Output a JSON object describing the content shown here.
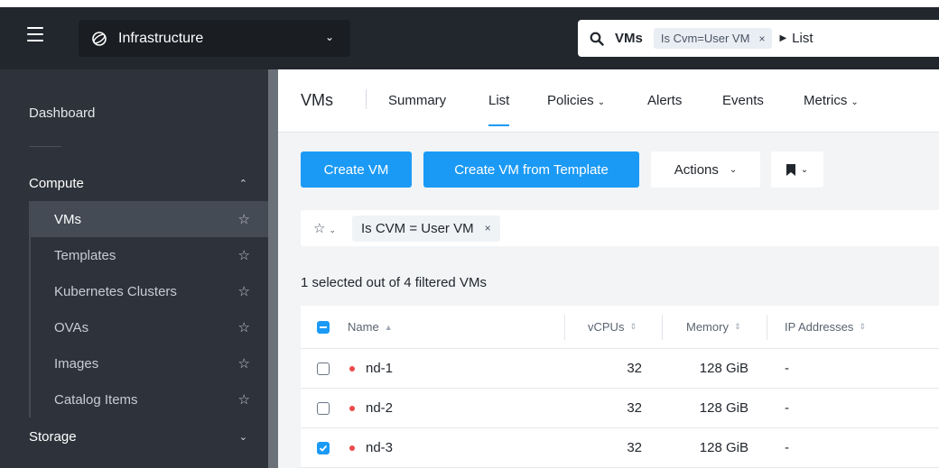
{
  "header": {
    "app_name": "Infrastructure",
    "search": {
      "scope": "VMs",
      "chip": "Is Cvm=User VM",
      "chip_remove": "×",
      "view": "List"
    }
  },
  "sidebar": {
    "dashboard": "Dashboard",
    "compute_label": "Compute",
    "compute_items": [
      {
        "label": "VMs",
        "active": true
      },
      {
        "label": "Templates"
      },
      {
        "label": "Kubernetes Clusters"
      },
      {
        "label": "OVAs"
      },
      {
        "label": "Images"
      },
      {
        "label": "Catalog Items"
      }
    ],
    "storage_label": "Storage"
  },
  "page": {
    "title": "VMs",
    "tabs": [
      "Summary",
      "List",
      "Policies",
      "Alerts",
      "Events",
      "Metrics"
    ],
    "active_tab": "List"
  },
  "toolbar": {
    "create_vm": "Create VM",
    "create_from_template": "Create VM from Template",
    "actions": "Actions"
  },
  "filter": {
    "chip": "Is CVM = User VM",
    "chip_remove": "×"
  },
  "selection_text": "1 selected out of 4 filtered VMs",
  "table": {
    "columns": [
      "Name",
      "vCPUs",
      "Memory",
      "IP Addresses"
    ],
    "rows": [
      {
        "name": "nd-1",
        "vcpus": "32",
        "memory": "128 GiB",
        "ip": "-",
        "selected": false
      },
      {
        "name": "nd-2",
        "vcpus": "32",
        "memory": "128 GiB",
        "ip": "-",
        "selected": false
      },
      {
        "name": "nd-3",
        "vcpus": "32",
        "memory": "128 GiB",
        "ip": "-",
        "selected": true
      }
    ]
  },
  "colors": {
    "accent": "#1b9af5",
    "header_bg": "#22272e",
    "sidebar_bg": "#2e333b",
    "status_red": "#ef4a4a"
  }
}
